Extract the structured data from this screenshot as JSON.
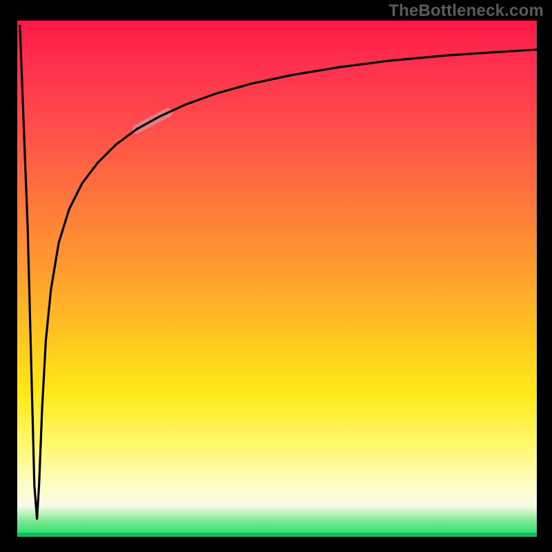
{
  "watermark": "TheBottleneck.com",
  "chart_data": {
    "type": "line",
    "title": "",
    "xlabel": "",
    "ylabel": "",
    "xlim": [
      0,
      100
    ],
    "ylim": [
      0,
      100
    ],
    "grid": false,
    "legend": false,
    "series": [
      {
        "name": "bottleneck-curve",
        "x": [
          0.5,
          2.0,
          3.3,
          3.8,
          4.2,
          4.8,
          5.5,
          6.5,
          8.0,
          10.0,
          12.5,
          15.5,
          19.0,
          23.0,
          27.5,
          32.5,
          38.0,
          45.0,
          53.0,
          62.0,
          72.0,
          83.0,
          92.0,
          100.0
        ],
        "y": [
          99.0,
          60.0,
          10.0,
          3.5,
          10.0,
          25.0,
          38.0,
          48.0,
          57.0,
          63.5,
          68.5,
          72.5,
          76.0,
          79.0,
          81.5,
          83.8,
          85.8,
          87.8,
          89.5,
          91.0,
          92.3,
          93.3,
          93.9,
          94.4
        ]
      }
    ],
    "highlighted_segment": {
      "x_from": 23.0,
      "x_to": 29.0,
      "y_from": 79.0,
      "y_to": 82.2
    },
    "colors": {
      "curve": "#000000",
      "highlight": "#d78b96",
      "gradient_top": "#ff1744",
      "gradient_bottom": "#1edb6d"
    }
  }
}
